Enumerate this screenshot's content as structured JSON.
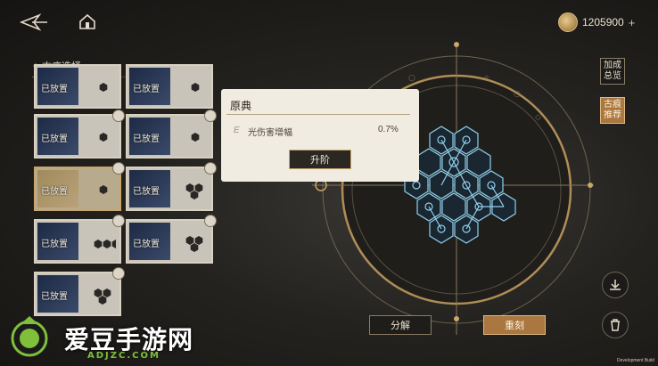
{
  "topbar": {
    "currency_value": "1205900",
    "plus_label": "+"
  },
  "panel": {
    "title": "古痕选择",
    "cards": [
      {
        "label": "已放置",
        "selected": false
      },
      {
        "label": "已放置",
        "selected": false
      },
      {
        "label": "已放置",
        "selected": false
      },
      {
        "label": "已放置",
        "selected": false
      },
      {
        "label": "已放置",
        "selected": true
      },
      {
        "label": "已放置",
        "selected": false
      },
      {
        "label": "已放置",
        "selected": false
      },
      {
        "label": "已放置",
        "selected": false
      },
      {
        "label": "已放置",
        "selected": false
      }
    ]
  },
  "popup": {
    "title": "原典",
    "stat_name": "光伤害增幅",
    "stat_value": "0.7%",
    "upgrade_label": "升阶"
  },
  "right_buttons": {
    "bonus_overview": "加成总览",
    "recommend": "古痕推荐"
  },
  "bottom_buttons": {
    "dismantle": "分解",
    "reforge": "重刻"
  },
  "footer": {
    "dev_build": "Development Build"
  },
  "watermark": {
    "text": "爱豆手游网",
    "domain": "ADJZC.COM"
  },
  "colors": {
    "accent_gold": "#c9a66b",
    "accent_orange": "#a9773f",
    "circuit_blue": "#8fd0ee"
  }
}
